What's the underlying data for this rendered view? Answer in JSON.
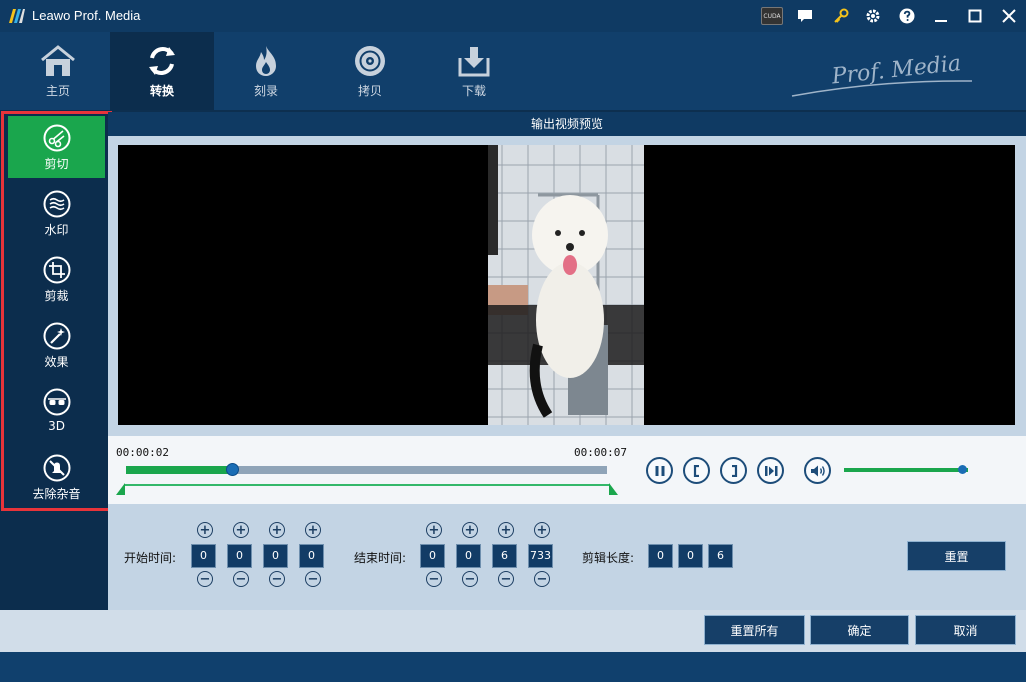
{
  "app": {
    "title": "Leawo Prof. Media",
    "brand": "Prof. Media"
  },
  "titlebar": {
    "cuda_label": "CUDA"
  },
  "nav": {
    "items": [
      {
        "label": "主页",
        "icon": "home-icon"
      },
      {
        "label": "转换",
        "icon": "convert-icon",
        "active": true
      },
      {
        "label": "刻录",
        "icon": "burn-icon"
      },
      {
        "label": "拷贝",
        "icon": "disc-copy-icon"
      },
      {
        "label": "下载",
        "icon": "download-icon"
      }
    ]
  },
  "sidebar": {
    "items": [
      {
        "label": "剪切",
        "icon": "scissors-icon",
        "active": true
      },
      {
        "label": "水印",
        "icon": "watermark-icon"
      },
      {
        "label": "剪裁",
        "icon": "crop-icon"
      },
      {
        "label": "效果",
        "icon": "effect-wand-icon"
      },
      {
        "label": "3D",
        "icon": "3d-glasses-icon"
      },
      {
        "label": "去除杂音",
        "icon": "noise-remove-icon"
      }
    ]
  },
  "preview": {
    "header": "输出视频预览"
  },
  "timeline": {
    "current_time": "00:00:02",
    "end_time": "00:00:07",
    "progress": 0.22
  },
  "volume": {
    "level": 0.95
  },
  "time_settings": {
    "start_label": "开始时间:",
    "start_values": [
      "0",
      "0",
      "0",
      "0"
    ],
    "end_label": "结束时间:",
    "end_values": [
      "0",
      "0",
      "6",
      "733"
    ],
    "length_label": "剪辑长度:",
    "length_values": [
      "0",
      "0",
      "6"
    ],
    "plus": "+",
    "minus": "−"
  },
  "buttons": {
    "reset": "重置",
    "reset_all": "重置所有",
    "ok": "确定",
    "cancel": "取消"
  },
  "colors": {
    "accent_green": "#1aa64d",
    "dark_navy": "#0c2d4d",
    "highlight_red": "#e8343a"
  }
}
